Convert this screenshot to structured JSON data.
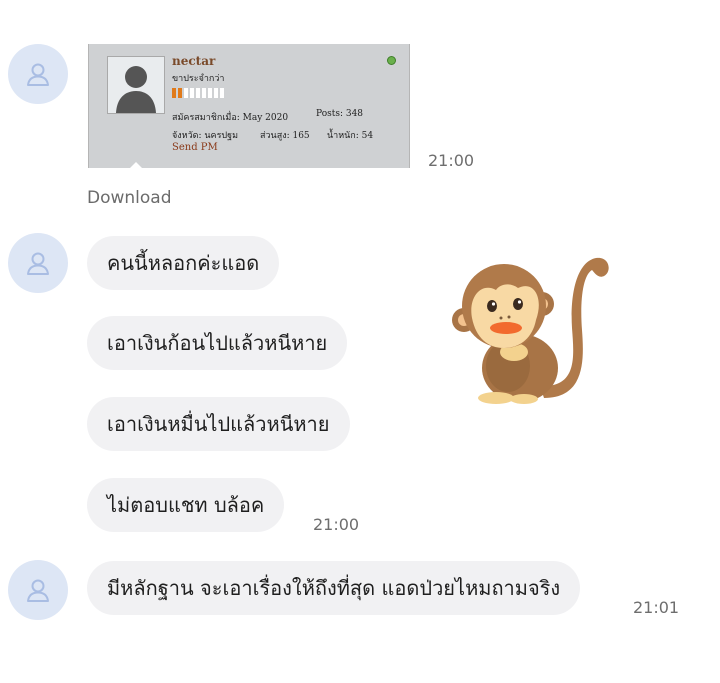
{
  "messages": [
    {
      "type": "image",
      "card": {
        "username": "nectar",
        "rank": "ขาประจำกว่า",
        "member_since": "สมัครสมาชิกเมื่อ: May 2020",
        "posts": "Posts: 348",
        "location": "จังหวัด: นครปฐม",
        "height": "ส่วนสูง: 165",
        "weight": "น้ำหนัก: 54",
        "send_pm": "Send PM"
      },
      "time": "21:00",
      "download_label": "Download"
    },
    {
      "type": "text-group",
      "lines": [
        "คนนี้หลอกค่ะแอด",
        "เอาเงินก้อนไปแล้วหนีหาย",
        "เอาเงินหมื่นไปแล้วหนีหาย",
        "ไม่ตอบแชท บล้อค"
      ],
      "time": "21:00",
      "sticker": "monkey-sticker"
    },
    {
      "type": "text",
      "text": "มีหลักฐาน จะเอาเรื่องให้ถึงที่สุด แอดป่วยไหมถามจริง",
      "time": "21:01"
    }
  ],
  "colors": {
    "avatar_bg": "#dde6f5",
    "avatar_icon": "#a9bde3",
    "bubble_bg": "#f1f1f3",
    "time_text": "#6e6e6e"
  }
}
